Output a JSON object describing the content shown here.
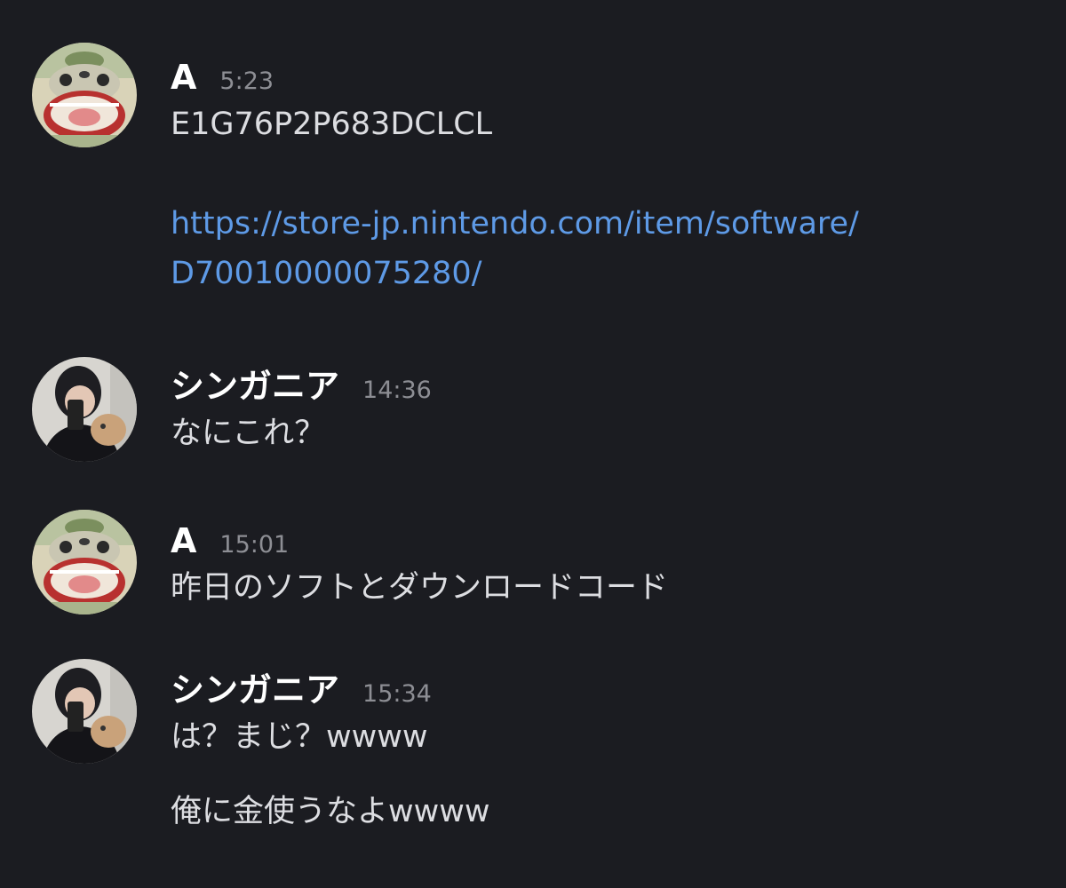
{
  "colors": {
    "background": "#1b1c21",
    "username": "#ffffff",
    "timestamp": "#8d8e94",
    "text": "#dcdde1",
    "link": "#5e9ae6"
  },
  "messages": [
    {
      "avatar": "cartoon-face-avatar",
      "username": "A",
      "time": "5:23",
      "code": "E1G76P2P683DCLCL",
      "link_line1": "https://store-jp.nintendo.com/item/software/",
      "link_line2": "D70010000075280/"
    },
    {
      "avatar": "person-photo-avatar",
      "username": "シンガニア",
      "time": "14:36",
      "text": "なにこれ？"
    },
    {
      "avatar": "cartoon-face-avatar",
      "username": "A",
      "time": "15:01",
      "text": "昨日のソフトとダウンロードコード"
    },
    {
      "avatar": "person-photo-avatar",
      "username": "シンガニア",
      "time": "15:34",
      "text": "は？まじ？wwww",
      "text2": "俺に金使うなよwwww"
    }
  ]
}
